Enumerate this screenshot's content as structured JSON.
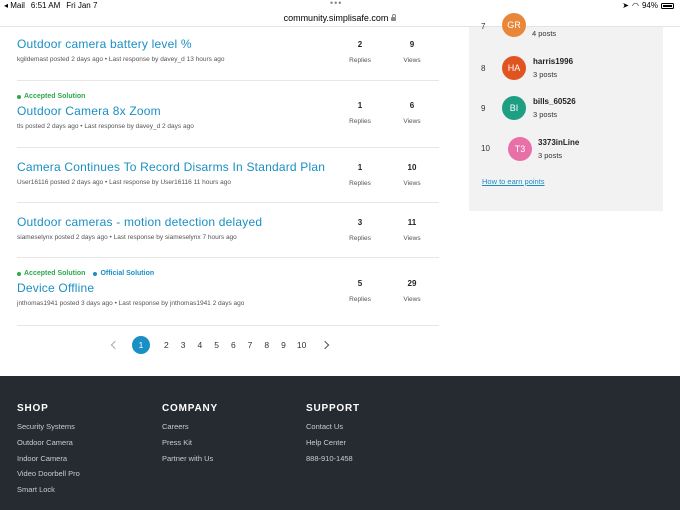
{
  "status_bar": {
    "back_app": "◂ Mail",
    "time": "6:51 AM",
    "date": "Fri Jan 7",
    "battery": "94%"
  },
  "browser": {
    "url": "community.simplisafe.com"
  },
  "topics": [
    {
      "badges": [],
      "title": "Outdoor camera battery level %",
      "meta": "kgildemast posted 2 days ago • Last response by davey_d 13 hours ago",
      "replies": "2",
      "views": "9"
    },
    {
      "badges": [
        "Accepted Solution"
      ],
      "title": "Outdoor Camera 8x Zoom",
      "meta": "tls posted 2 days ago • Last response by davey_d 2 days ago",
      "replies": "1",
      "views": "6"
    },
    {
      "badges": [],
      "title": "Camera Continues To Record Disarms In Standard Plan",
      "meta": "User16116 posted 2 days ago • Last response by User16116 11 hours ago",
      "replies": "1",
      "views": "10"
    },
    {
      "badges": [],
      "title": "Outdoor cameras - motion detection delayed",
      "meta": "siameselynx posted 2 days ago • Last response by siameselynx 7 hours ago",
      "replies": "3",
      "views": "11"
    },
    {
      "badges": [
        "Accepted Solution",
        "Official Solution"
      ],
      "title": "Device Offline",
      "meta": "jnthomas1941 posted 3 days ago • Last response by jnthomas1941 2 days ago",
      "replies": "5",
      "views": "29"
    }
  ],
  "labels": {
    "replies": "Replies",
    "views": "Views"
  },
  "leaderboard": [
    {
      "rank": "7",
      "initials": "GR",
      "name": "",
      "posts": "4 posts",
      "color": "#e8873a"
    },
    {
      "rank": "8",
      "initials": "HA",
      "name": "harris1996",
      "posts": "3 posts",
      "color": "#e0541f"
    },
    {
      "rank": "9",
      "initials": "BI",
      "name": "bills_60526",
      "posts": "3 posts",
      "color": "#1e9e82"
    },
    {
      "rank": "10",
      "initials": "T3",
      "name": "3373inLine",
      "posts": "3 posts",
      "color": "#e86fa8"
    }
  ],
  "earn_points": "How to earn points",
  "pagination": {
    "current": "1",
    "pages": [
      "2",
      "3",
      "4",
      "5",
      "6",
      "7",
      "8",
      "9",
      "10"
    ]
  },
  "footer": {
    "shop": {
      "heading": "SHOP",
      "links": [
        "Security Systems",
        "Outdoor Camera",
        "Indoor Camera",
        "Video Doorbell Pro",
        "Smart Lock"
      ]
    },
    "company": {
      "heading": "COMPANY",
      "links": [
        "Careers",
        "Press Kit",
        "Partner with Us"
      ]
    },
    "support": {
      "heading": "SUPPORT",
      "links": [
        "Contact Us",
        "Help Center",
        "888-910-1458"
      ]
    }
  },
  "colors": {
    "accent": "#1a8fc4",
    "accepted": "#2fa84f",
    "footer_bg": "#262a31"
  }
}
